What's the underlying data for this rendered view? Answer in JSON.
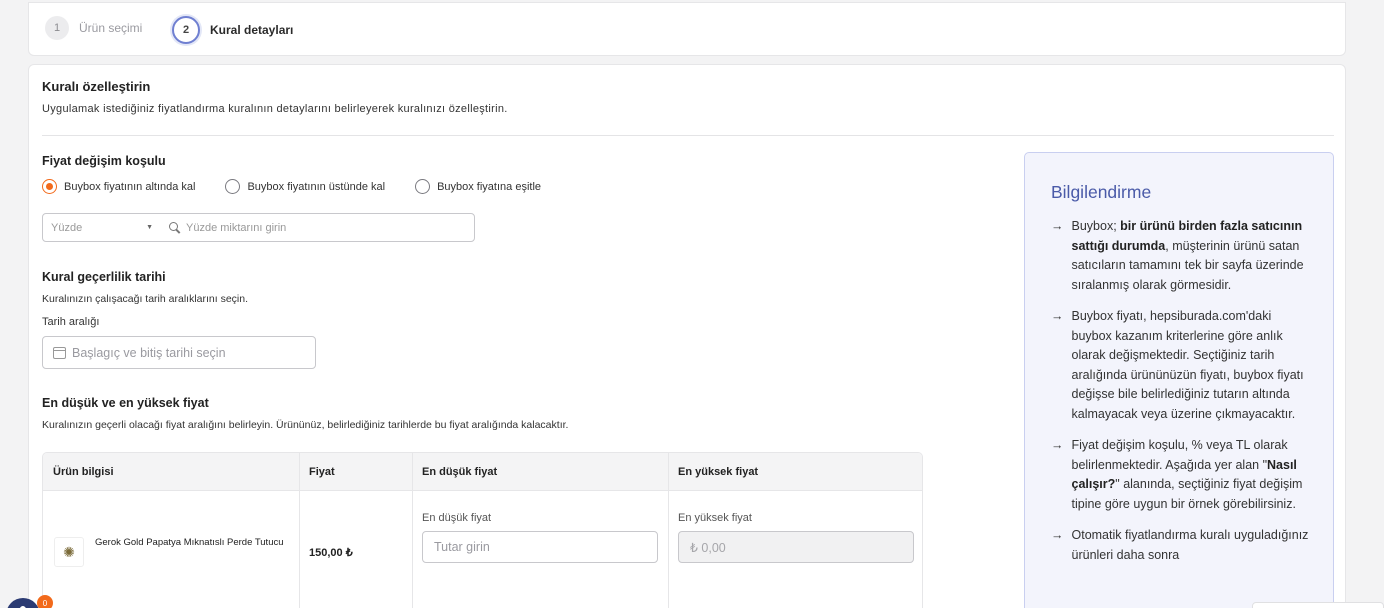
{
  "stepper": {
    "steps": [
      {
        "number": "1",
        "label": "Ürün seçimi"
      },
      {
        "number": "2",
        "label": "Kural detayları"
      }
    ]
  },
  "header": {
    "title": "Kuralı özelleştirin",
    "description": "Uygulamak istediğiniz fiyatlandırma kuralının detaylarını belirleyerek kuralınızı özelleştirin."
  },
  "price_condition": {
    "title": "Fiyat değişim koşulu",
    "options": [
      "Buybox fiyatının altında kal",
      "Buybox fiyatının üstünde kal",
      "Buybox fiyatına eşitle"
    ],
    "selected_index": 0,
    "type_select_placeholder": "Yüzde",
    "amount_placeholder": "Yüzde miktarını girin"
  },
  "validity": {
    "title": "Kural geçerlilik tarihi",
    "description": "Kuralınızın çalışacağı tarih aralıklarını seçin.",
    "date_label": "Tarih aralığı",
    "date_placeholder": "Başlagıç ve bitiş tarihi seçin"
  },
  "min_max": {
    "title": "En düşük ve en yüksek fiyat",
    "description": "Kuralınızın geçerli olacağı fiyat aralığını belirleyin. Ürününüz, belirlediğiniz tarihlerde bu fiyat aralığında kalacaktır.",
    "table": {
      "headers": [
        "Ürün bilgisi",
        "Fiyat",
        "En düşük fiyat",
        "En yüksek fiyat"
      ],
      "rows": [
        {
          "product_name": "Gerok Gold Papatya Mıknatıslı Perde Tutucu",
          "price": "150,00 ₺",
          "min_label": "En düşük fiyat",
          "min_placeholder": "Tutar girin",
          "max_label": "En yüksek fiyat",
          "max_placeholder": "₺ 0,00"
        }
      ]
    }
  },
  "info_panel": {
    "title": "Bilgilendirme",
    "items": [
      {
        "pre": "Buybox; ",
        "bold": "bir ürünü birden fazla satıcının sattığı durumda",
        "post": ", müşterinin ürünü satan satıcıların tamamını tek bir sayfa üzerinde sıralanmış olarak görmesidir."
      },
      {
        "pre": "Buybox fiyatı, hepsiburada.com'daki buybox kazanım kriterlerine göre anlık olarak değişmektedir. Seçtiğiniz tarih aralığında ürününüzün fiyatı, buybox fiyatı değişse bile belirlediğiniz tutarın altında kalmayacak veya üzerine çıkmayacaktır.",
        "bold": "",
        "post": ""
      },
      {
        "pre": "Fiyat değişim koşulu, % veya TL olarak belirlenmektedir. Aşağıda yer alan \"",
        "bold": "Nasıl çalışır?",
        "post": "\" alanında, seçtiğiniz fiyat değişim tipine göre uygun bir örnek görebilirsiniz."
      },
      {
        "pre": "Otomatik fiyatlandırma kuralı uyguladığınız ürünleri daha sonra",
        "bold": "",
        "post": ""
      }
    ]
  },
  "fab": {
    "badge": "0"
  },
  "colors": {
    "accent": "#f26a1b",
    "info_title": "#4a5aa8",
    "info_bg": "#f3f4fc"
  }
}
